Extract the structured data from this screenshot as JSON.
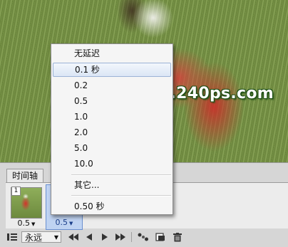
{
  "watermark": "www.240ps.com",
  "timeline": {
    "tab_label": "时间轴",
    "frames": [
      {
        "number": "1",
        "delay": "0.5"
      },
      {
        "number": "",
        "delay": "0.5"
      }
    ],
    "loop": "永远"
  },
  "delay_menu": {
    "items": [
      "无延迟",
      "0.1 秒",
      "0.2",
      "0.5",
      "1.0",
      "2.0",
      "5.0",
      "10.0",
      "其它...",
      "0.50 秒"
    ],
    "highlighted_index": 1
  },
  "icons": {
    "timeline_menu": "frames-list-icon",
    "first_frame": "first-frame-icon",
    "prev_frame": "prev-frame-icon",
    "play": "play-icon",
    "next_frame": "next-frame-icon",
    "tween": "tween-icon",
    "duplicate": "duplicate-frame-icon",
    "delete": "trash-icon"
  }
}
